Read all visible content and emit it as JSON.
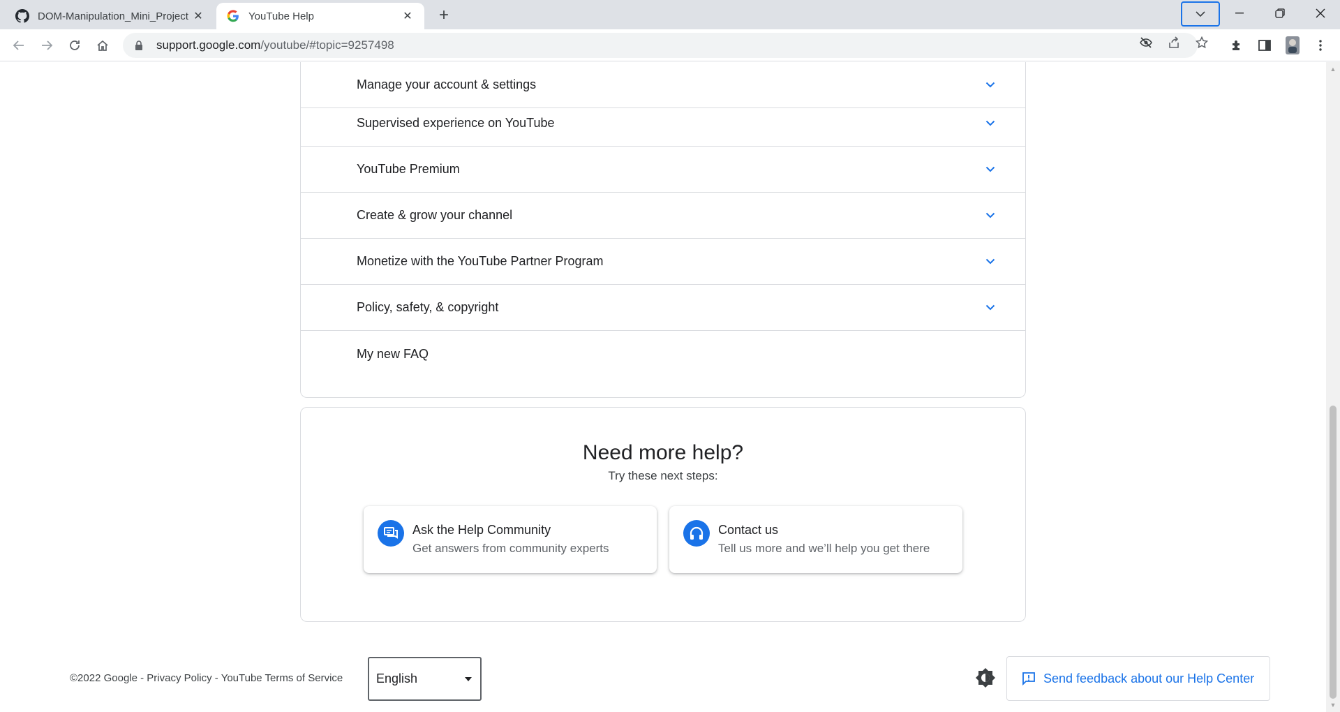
{
  "browser": {
    "tabs": [
      {
        "title": "DOM-Manipulation_Mini_Project",
        "icon": "github-icon",
        "active": false
      },
      {
        "title": "YouTube Help",
        "icon": "google-icon",
        "active": true
      }
    ],
    "new_tab_label": "+",
    "url_host": "support.google.com",
    "url_path": "/youtube/#topic=9257498"
  },
  "topics": [
    {
      "label": "Manage your account & settings"
    },
    {
      "label": "Supervised experience on YouTube"
    },
    {
      "label": "YouTube Premium"
    },
    {
      "label": "Create & grow your channel"
    },
    {
      "label": "Monetize with the YouTube Partner Program"
    },
    {
      "label": "Policy, safety, & copyright"
    },
    {
      "label": "My new FAQ"
    }
  ],
  "help": {
    "title": "Need more help?",
    "subtitle": "Try these next steps:",
    "options": [
      {
        "title": "Ask the Help Community",
        "desc": "Get answers from community experts",
        "icon": "forum-icon"
      },
      {
        "title": "Contact us",
        "desc": "Tell us more and we’ll help you get there",
        "icon": "headset-icon"
      }
    ]
  },
  "footer": {
    "copyright": "©2022 Google - Privacy Policy - YouTube Terms of Service",
    "language": "English",
    "feedback_label": "Send feedback about our Help Center"
  },
  "colors": {
    "accent": "#1a73e8",
    "border": "#dadce0",
    "text": "#202124"
  }
}
